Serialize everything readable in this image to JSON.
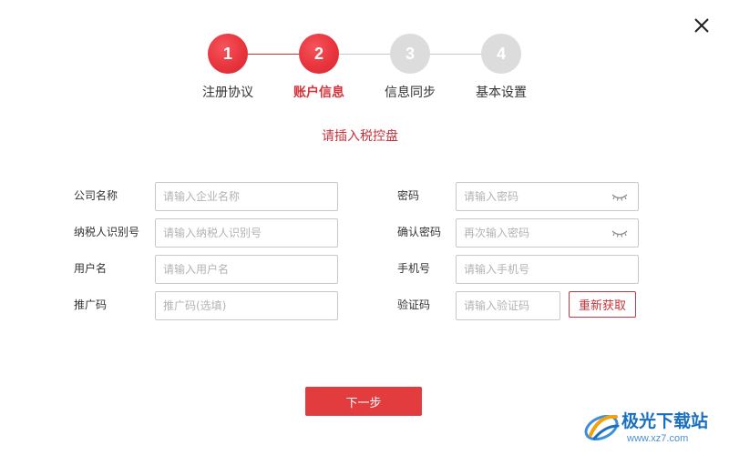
{
  "window": {
    "close_icon": "close-icon"
  },
  "stepper": {
    "steps": [
      {
        "number": "1",
        "label": "注册协议",
        "state": "done"
      },
      {
        "number": "2",
        "label": "账户信息",
        "state": "current"
      },
      {
        "number": "3",
        "label": "信息同步",
        "state": "pending"
      },
      {
        "number": "4",
        "label": "基本设置",
        "state": "pending"
      }
    ]
  },
  "hint": "请插入税控盘",
  "form": {
    "company_name": {
      "label": "公司名称",
      "placeholder": "请输入企业名称"
    },
    "taxpayer_id": {
      "label": "纳税人识别号",
      "placeholder": "请输入纳税人识别号"
    },
    "username": {
      "label": "用户名",
      "placeholder": "请输入用户名"
    },
    "promo_code": {
      "label": "推广码",
      "placeholder": "推广码(选填)"
    },
    "password": {
      "label": "密码",
      "placeholder": "请输入密码",
      "icon": "eye-closed-icon"
    },
    "confirm_password": {
      "label": "确认密码",
      "placeholder": "再次输入密码",
      "icon": "eye-closed-icon"
    },
    "phone": {
      "label": "手机号",
      "placeholder": "请输入手机号"
    },
    "verify_code": {
      "label": "验证码",
      "placeholder": "请输入验证码"
    },
    "resend_label": "重新获取"
  },
  "next_label": "下一步",
  "watermark": {
    "name": "极光下载站",
    "url": "www.xz7.com"
  },
  "colors": {
    "accent": "#e23c3f",
    "inactive": "#dcdcdc",
    "watermark": "#1a6fc0"
  }
}
